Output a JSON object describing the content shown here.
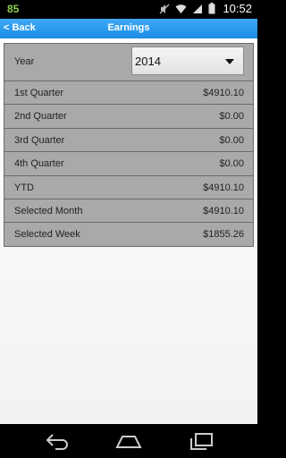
{
  "status_bar": {
    "notification_count": "85",
    "time": "10:52",
    "icons": [
      "mute-icon",
      "wifi-icon",
      "signal-icon",
      "battery-icon"
    ]
  },
  "action_bar": {
    "back_label": "< Back",
    "title": "Earnings",
    "color": "#2a9cee"
  },
  "year_selector": {
    "label": "Year",
    "selected": "2014"
  },
  "rows": [
    {
      "label": "1st Quarter",
      "value": "$4910.10"
    },
    {
      "label": "2nd Quarter",
      "value": "$0.00"
    },
    {
      "label": "3rd Quarter",
      "value": "$0.00"
    },
    {
      "label": "4th Quarter",
      "value": "$0.00"
    },
    {
      "label": "YTD",
      "value": "$4910.10"
    },
    {
      "label": "Selected Month",
      "value": "$4910.10"
    },
    {
      "label": "Selected Week",
      "value": "$1855.26"
    }
  ],
  "nav_bar": {
    "icons": [
      "back-icon",
      "home-icon",
      "recents-icon"
    ]
  }
}
